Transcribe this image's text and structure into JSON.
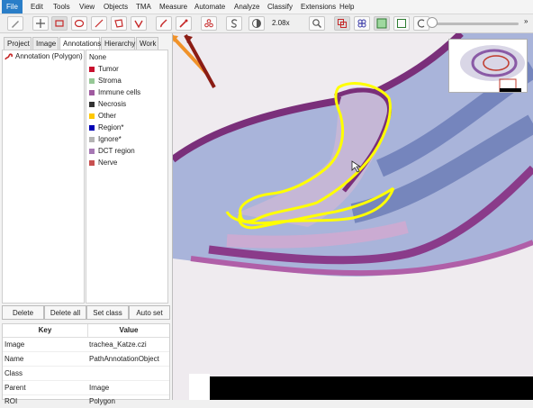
{
  "menubar": {
    "items": [
      "File",
      "Edit",
      "Tools",
      "View",
      "Objects",
      "TMA",
      "Measure",
      "Automate",
      "Analyze",
      "Classify",
      "Extensions",
      "Help"
    ]
  },
  "toolbar": {
    "zoom": "2.08x",
    "icons": [
      "toggle-sidebar",
      "move",
      "rectangle",
      "ellipse",
      "line",
      "polygon",
      "polyline",
      "brush",
      "wand",
      "points",
      "show-objects",
      "contrast",
      "zoom-to-fit",
      "show-annotations",
      "show-tma-grid",
      "fill-detections",
      "show-pixel-classification"
    ]
  },
  "tabs": [
    "Project",
    "Image",
    "Annotations",
    "Hierarchy",
    "Work"
  ],
  "annotations": {
    "items": [
      {
        "label": "Annotation (Polygon)",
        "color": "#c62828"
      }
    ]
  },
  "classes": [
    {
      "name": "None",
      "color": null
    },
    {
      "name": "Tumor",
      "color": "#c8102e"
    },
    {
      "name": "Stroma",
      "color": "#96c896"
    },
    {
      "name": "Immune cells",
      "color": "#a05aa0"
    },
    {
      "name": "Necrosis",
      "color": "#323232"
    },
    {
      "name": "Other",
      "color": "#ffc800"
    },
    {
      "name": "Region*",
      "color": "#0000b4"
    },
    {
      "name": "Ignore*",
      "color": "#b4b4b4"
    },
    {
      "name": "DCT region",
      "color": "#a678b4"
    },
    {
      "name": "Nerve",
      "color": "#c85050"
    }
  ],
  "buttons": {
    "delete": "Delete",
    "delete_all": "Delete all",
    "set_class": "Set class",
    "auto_set": "Auto set"
  },
  "properties": {
    "headers": {
      "key": "Key",
      "value": "Value"
    },
    "rows": [
      {
        "key": "Image",
        "value": "trachea_Katze.czi"
      },
      {
        "key": "Name",
        "value": "PathAnnotationObject"
      },
      {
        "key": "Class",
        "value": ""
      },
      {
        "key": "Parent",
        "value": "Image"
      },
      {
        "key": "ROI",
        "value": "Polygon"
      }
    ]
  },
  "colors": {
    "accent": "#2a7ec8",
    "annotation_outline": "#ffff00",
    "arrow_orange": "#f0922a",
    "arrow_darkred": "#8b1c14",
    "tissue_purple": "#7a2f7a",
    "tissue_blue": "#6f7fbf"
  }
}
